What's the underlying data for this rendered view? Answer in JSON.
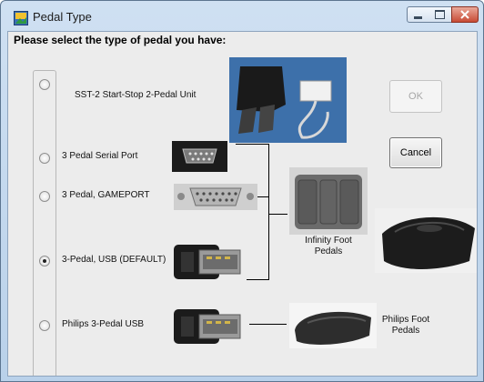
{
  "window": {
    "title": "Pedal Type"
  },
  "prompt": "Please select the type of pedal you have:",
  "options": [
    {
      "label": "SST-2 Start-Stop  2-Pedal Unit",
      "selected": false
    },
    {
      "label": "3 Pedal Serial Port",
      "selected": false
    },
    {
      "label": "3 Pedal, GAMEPORT",
      "selected": false
    },
    {
      "label": "3-Pedal, USB (DEFAULT)",
      "selected": true
    },
    {
      "label": "Philips 3-Pedal USB",
      "selected": false
    }
  ],
  "buttons": {
    "ok": "OK",
    "cancel": "Cancel"
  },
  "captions": {
    "infinity": "Infinity Foot Pedals",
    "philips": "Philips Foot Pedals"
  },
  "colors": {
    "title_bar": "#b9d1ea",
    "client_bg": "#ececec",
    "close_button": "#c84b36"
  }
}
